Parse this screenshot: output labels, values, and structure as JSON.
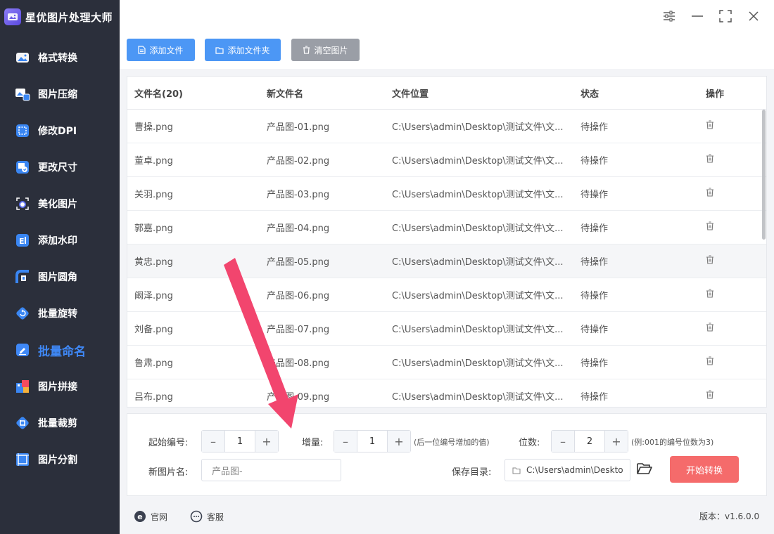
{
  "app": {
    "title": "星优图片处理大师",
    "version": "版本：v1.6.0.0"
  },
  "sidebar": {
    "items": [
      {
        "label": "格式转换",
        "icon": "image-convert-icon",
        "color": "#4a8df7"
      },
      {
        "label": "图片压缩",
        "icon": "image-compress-icon",
        "color": "#4a8df7"
      },
      {
        "label": "修改DPI",
        "icon": "dpi-icon",
        "color": "#3a86f2"
      },
      {
        "label": "更改尺寸",
        "icon": "resize-icon",
        "color": "#3a86f2"
      },
      {
        "label": "美化图片",
        "icon": "beautify-icon",
        "color": "#5a6cf0"
      },
      {
        "label": "添加水印",
        "icon": "watermark-icon",
        "color": "#3a86f2"
      },
      {
        "label": "图片圆角",
        "icon": "round-corner-icon",
        "color": "#3a86f2"
      },
      {
        "label": "批量旋转",
        "icon": "rotate-icon",
        "color": "#3a86f2"
      },
      {
        "label": "批量命名",
        "icon": "rename-icon",
        "color": "#3f88f6",
        "active": true
      },
      {
        "label": "图片拼接",
        "icon": "stitch-icon",
        "color": "#3a86f2"
      },
      {
        "label": "批量裁剪",
        "icon": "crop-icon",
        "color": "#3a86f2"
      },
      {
        "label": "图片分割",
        "icon": "split-icon",
        "color": "#3a86f2"
      }
    ]
  },
  "toolbar": {
    "add_file": "添加文件",
    "add_folder": "添加文件夹",
    "clear": "清空图片"
  },
  "table": {
    "headers": [
      "文件名(20)",
      "新文件名",
      "文件位置",
      "状态",
      "操作"
    ],
    "rows": [
      {
        "name": "曹操.png",
        "new": "产品图-01.png",
        "path": "C:\\Users\\admin\\Desktop\\测试文件\\文...",
        "status": "待操作"
      },
      {
        "name": "董卓.png",
        "new": "产品图-02.png",
        "path": "C:\\Users\\admin\\Desktop\\测试文件\\文...",
        "status": "待操作"
      },
      {
        "name": "关羽.png",
        "new": "产品图-03.png",
        "path": "C:\\Users\\admin\\Desktop\\测试文件\\文...",
        "status": "待操作"
      },
      {
        "name": "郭嘉.png",
        "new": "产品图-04.png",
        "path": "C:\\Users\\admin\\Desktop\\测试文件\\文...",
        "status": "待操作"
      },
      {
        "name": "黄忠.png",
        "new": "产品图-05.png",
        "path": "C:\\Users\\admin\\Desktop\\测试文件\\文...",
        "status": "待操作"
      },
      {
        "name": "阚泽.png",
        "new": "产品图-06.png",
        "path": "C:\\Users\\admin\\Desktop\\测试文件\\文...",
        "status": "待操作"
      },
      {
        "name": "刘备.png",
        "new": "产品图-07.png",
        "path": "C:\\Users\\admin\\Desktop\\测试文件\\文...",
        "status": "待操作"
      },
      {
        "name": "鲁肃.png",
        "new": "产品图-08.png",
        "path": "C:\\Users\\admin\\Desktop\\测试文件\\文...",
        "status": "待操作"
      },
      {
        "name": "吕布.png",
        "new": "产品图-09.png",
        "path": "C:\\Users\\admin\\Desktop\\测试文件\\文...",
        "status": "待操作"
      }
    ]
  },
  "settings": {
    "start_label": "起始编号:",
    "start_value": "1",
    "increment_label": "增量:",
    "increment_value": "1",
    "increment_hint": "(后一位编号增加的值)",
    "digits_label": "位数:",
    "digits_value": "2",
    "digits_hint": "(例:001的编号位数为3)",
    "newname_label": "新图片名:",
    "newname_value": "产品图-",
    "save_label": "保存目录:",
    "save_value": "C:\\Users\\admin\\Deskto",
    "start_button": "开始转换"
  },
  "footer": {
    "website": "官网",
    "support": "客服"
  },
  "colors": {
    "accent": "#4c97f5",
    "start": "#f56b6b",
    "sidebar": "#2b2f3b",
    "arrow": "#f2456e"
  }
}
